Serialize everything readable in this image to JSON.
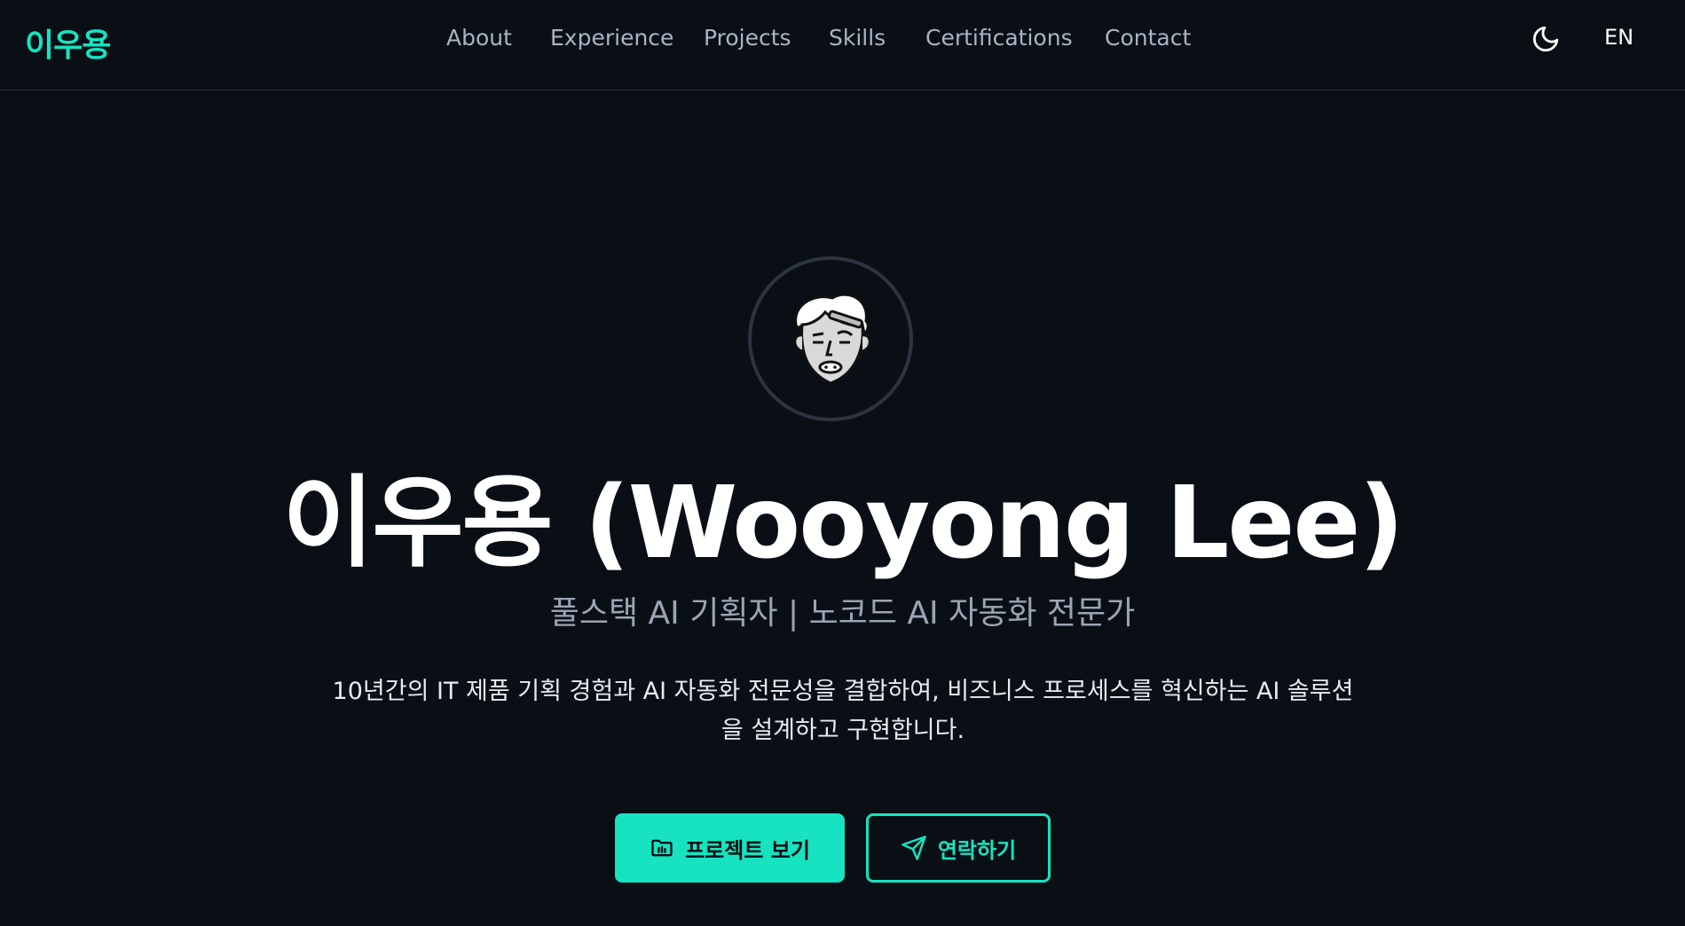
{
  "header": {
    "logo": "이우용",
    "nav": [
      "About",
      "Experience",
      "Projects",
      "Skills",
      "Certifications",
      "Contact"
    ],
    "theme_icon": "moon-icon",
    "language": "EN"
  },
  "hero": {
    "avatar_icon": "cartoon-face-avatar",
    "title": "이우용 (Wooyong Lee)",
    "subtitle": "풀스택 AI 기획자 | 노코드 AI 자동화 전문가",
    "description_line1": "10년간의 IT 제품 기획 경험과 AI 자동화 전문성을 결합하여, 비즈니스 프로세스를 혁신하는 AI 솔루션",
    "description_line2": "을 설계하고 구현합니다.",
    "primary_button": {
      "label": "프로젝트 보기",
      "icon": "folder-icon"
    },
    "secondary_button": {
      "label": "연락하기",
      "icon": "send-icon"
    }
  },
  "colors": {
    "background": "#0a0f16",
    "accent": "#17e3c0",
    "nav_text": "#a9b4c4",
    "subtitle_text": "#9aa5b4"
  }
}
